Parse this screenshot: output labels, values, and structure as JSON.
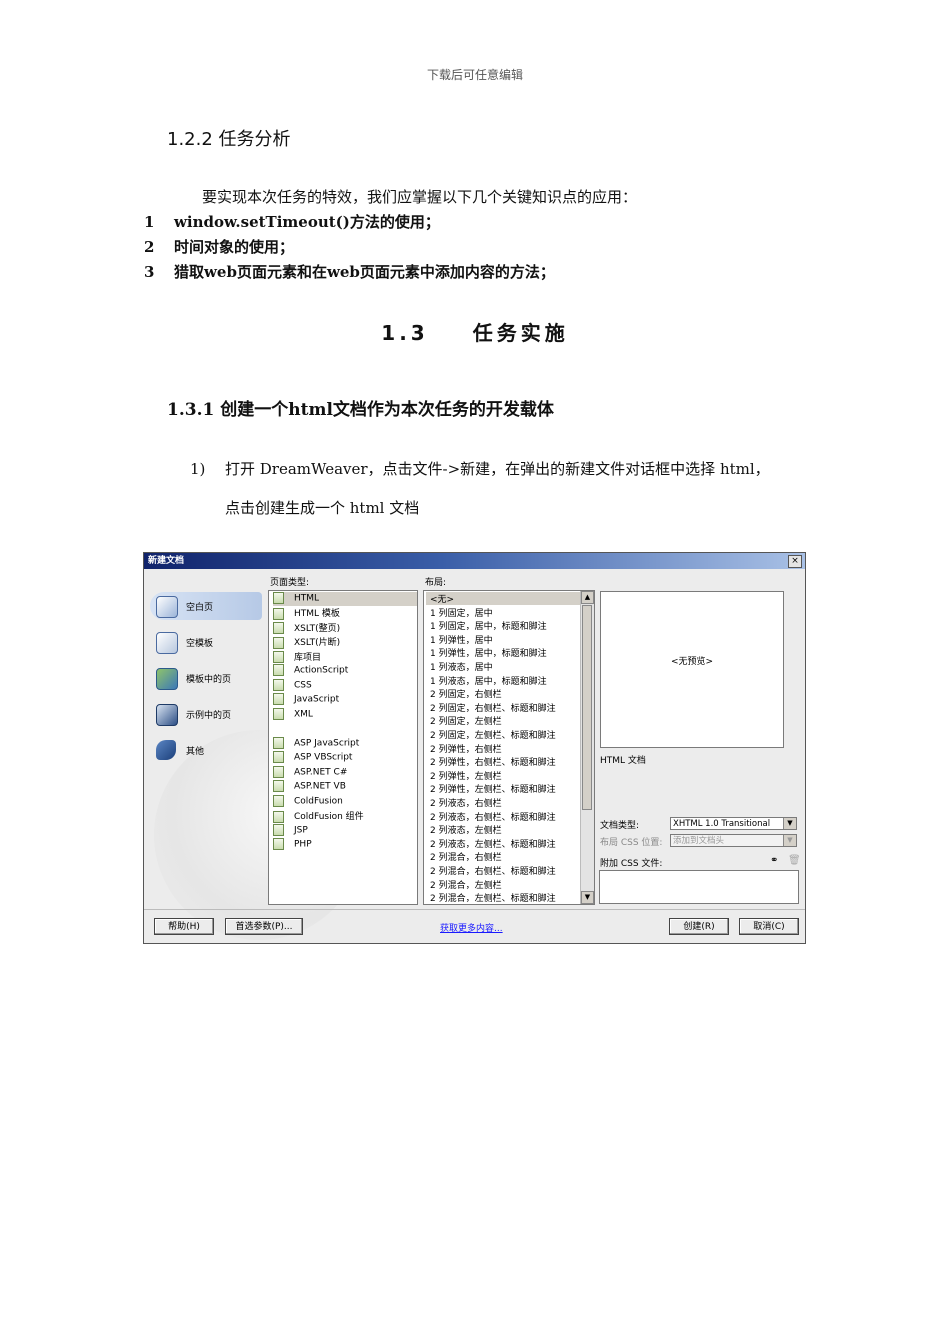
{
  "header": "下载后可任意编辑",
  "section_122": "1.2.2 任务分析",
  "intro": "要实现本次任务的特效，我们应掌握以下几个关键知识点的应用：",
  "key_points": [
    {
      "num": "1",
      "text": "window.setTimeout()方法的使用；"
    },
    {
      "num": "2",
      "text": "时间对象的使用；"
    },
    {
      "num": "3",
      "text": "猎取web页面元素和在web页面元素中添加内容的方法；"
    }
  ],
  "section_13": {
    "num": "1.3",
    "title": "任务实施"
  },
  "section_131": "1.3.1 创建一个html文档作为本次任务的开发载体",
  "step1": {
    "num": "1)",
    "line1": "打开 DreamWeaver，点击文件->新建，在弹出的新建文件对话框中选择 html，",
    "line2": "点击创建生成一个 html 文档"
  },
  "dialog": {
    "title": "新建文档",
    "close": "×",
    "nav": [
      "空白页",
      "空模板",
      "模板中的页",
      "示例中的页",
      "其他"
    ],
    "page_type_label": "页面类型:",
    "page_types": [
      "HTML",
      "HTML 模板",
      "XSLT(整页)",
      "XSLT(片断)",
      "库项目",
      "ActionScript",
      "CSS",
      "JavaScript",
      "XML",
      "ASP JavaScript",
      "ASP VBScript",
      "ASP.NET C#",
      "ASP.NET VB",
      "ColdFusion",
      "ColdFusion 组件",
      "JSP",
      "PHP"
    ],
    "layout_label": "布局:",
    "layouts": [
      "<无>",
      "1 列固定，居中",
      "1 列固定，居中，标题和脚注",
      "1 列弹性，居中",
      "1 列弹性，居中，标题和脚注",
      "1 列液态，居中",
      "1 列液态，居中，标题和脚注",
      "2 列固定，右侧栏",
      "2 列固定，右侧栏、标题和脚注",
      "2 列固定，左侧栏",
      "2 列固定，左侧栏、标题和脚注",
      "2 列弹性，右侧栏",
      "2 列弹性，右侧栏、标题和脚注",
      "2 列弹性，左侧栏",
      "2 列弹性，左侧栏、标题和脚注",
      "2 列液态，右侧栏",
      "2 列液态，右侧栏、标题和脚注",
      "2 列液态，左侧栏",
      "2 列液态，左侧栏、标题和脚注",
      "2 列混合，右侧栏",
      "2 列混合，右侧栏、标题和脚注",
      "2 列混合，左侧栏",
      "2 列混合，左侧栏、标题和脚注"
    ],
    "preview": "<无预览>",
    "doc_desc": "HTML 文档",
    "doctype_label": "文档类型:",
    "doctype_value": "XHTML 1.0 Transitional",
    "css_pos_label": "布局 CSS 位置:",
    "css_pos_value": "添加到文档头",
    "attach_css_label": "附加 CSS 文件:",
    "buttons": {
      "help": "帮助(H)",
      "prefs": "首选参数(P)...",
      "more": "获取更多内容...",
      "create": "创建(R)",
      "cancel": "取消(C)"
    }
  }
}
